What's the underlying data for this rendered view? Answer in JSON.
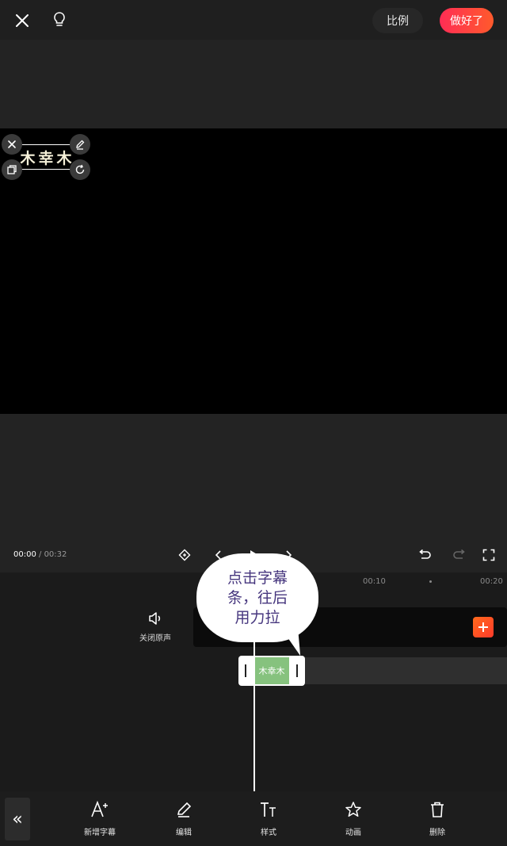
{
  "topbar": {
    "close_icon": "close-icon",
    "tips_icon": "lightbulb-icon",
    "ratio_label": "比例",
    "done_label": "做好了",
    "accent": "#ff2d55"
  },
  "preview": {
    "subtitle_text": "木幸木",
    "handles": [
      "close-icon",
      "edit-icon",
      "copy-icon",
      "rotate-icon"
    ]
  },
  "controls": {
    "current_time": "00:00",
    "separator": " / ",
    "total_time": "00:32",
    "icons": [
      "keyframe-icon",
      "prev-icon",
      "play-icon",
      "next-icon",
      "undo-icon",
      "redo-icon",
      "fullscreen-icon"
    ]
  },
  "timeline": {
    "ticks": [
      "00:10",
      "00:20"
    ],
    "mute_label": "关闭原声",
    "clip_text": "木幸木",
    "clip_color": "#86c27e"
  },
  "tip_bubble": {
    "line1": "点击字幕",
    "line2": "条，往后",
    "line3": "用力拉"
  },
  "toolbar": {
    "collapse_label": "«",
    "tools": [
      {
        "label": "新增字幕",
        "icon": "add-text-icon"
      },
      {
        "label": "编辑",
        "icon": "edit-icon"
      },
      {
        "label": "样式",
        "icon": "text-style-icon"
      },
      {
        "label": "动画",
        "icon": "star-icon"
      },
      {
        "label": "删除",
        "icon": "trash-icon"
      }
    ]
  }
}
